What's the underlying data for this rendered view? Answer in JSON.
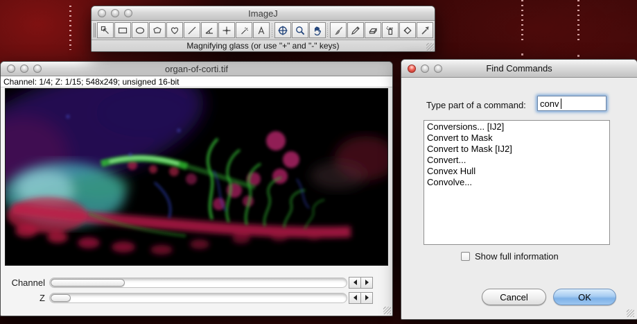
{
  "imagej_window": {
    "title": "ImageJ",
    "status_text": "Magnifying glass (or use \"+\" and \"-\" keys)",
    "tool_groups": {
      "selection": [
        "selection-pointer",
        "rectangle",
        "oval",
        "polygon",
        "freehand",
        "line",
        "angle",
        "point",
        "wand",
        "text"
      ],
      "view": [
        "crosshair",
        "magnifier",
        "hand"
      ],
      "draw": [
        "paintbrush",
        "pencil",
        "eraser",
        "spray-can",
        "paint-bucket",
        "arrow"
      ]
    }
  },
  "image_window": {
    "title": "organ-of-corti.tif",
    "info_bar": "Channel: 1/4; Z: 1/15; 548x249; unsigned 16-bit",
    "channel_slider": {
      "label": "Channel",
      "value": 1,
      "max": 4
    },
    "z_slider": {
      "label": "Z",
      "value": 1,
      "max": 15
    }
  },
  "find_commands": {
    "title": "Find Commands",
    "prompt_label": "Type part of a command:",
    "search_value": "conv",
    "results": [
      "Conversions... [IJ2]",
      "Convert to Mask",
      "Convert to Mask [IJ2]",
      "Convert...",
      "Convex Hull",
      "Convolve..."
    ],
    "show_full_info_label": "Show full information",
    "show_full_info_checked": false,
    "cancel_label": "Cancel",
    "ok_label": "OK"
  },
  "colors": {
    "ok_button": "#7fb2e8",
    "focus_ring": "#6ea0d7",
    "active_close_button": "#ef6156",
    "wallpaper_base": "#1c0404"
  }
}
